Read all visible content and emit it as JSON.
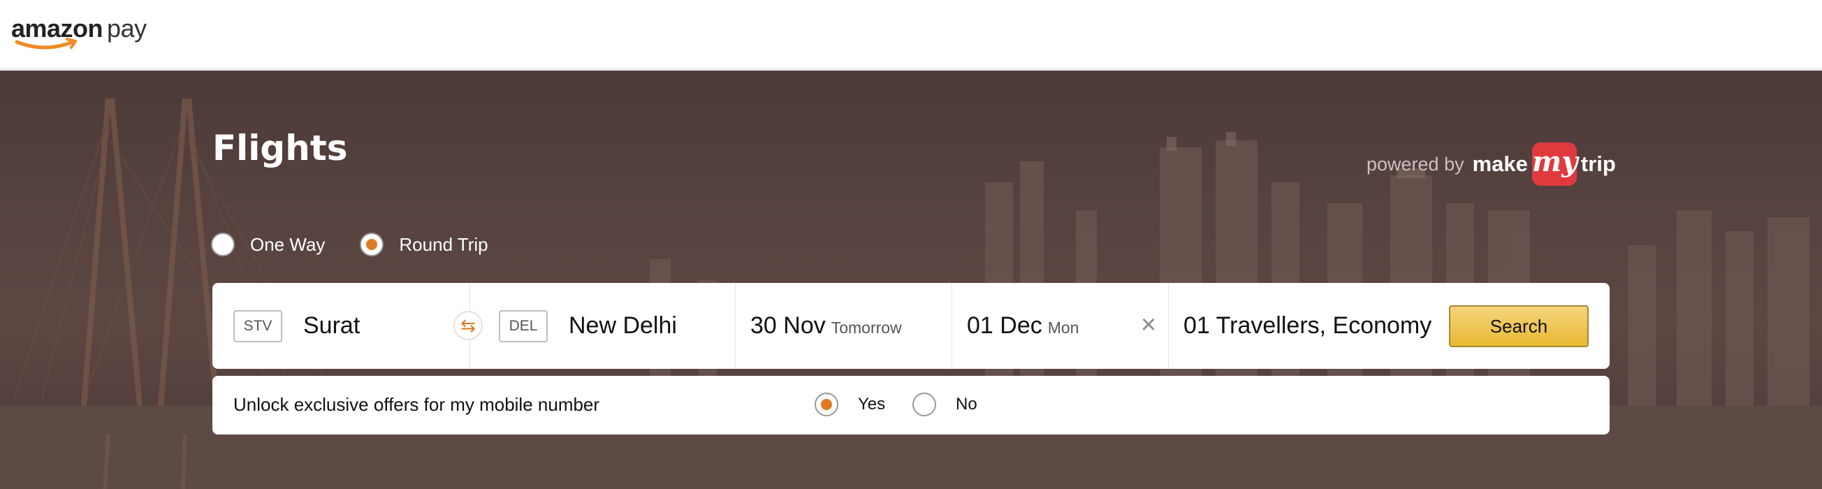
{
  "brand": {
    "logo_text": "amazon",
    "logo_suffix": "pay"
  },
  "page": {
    "title": "Flights"
  },
  "powered_by": {
    "prefix": "powered by",
    "make": "make",
    "my": "my",
    "trip": "trip",
    "brand_color": "#e03a3e"
  },
  "trip_type": {
    "options": [
      {
        "label": "One Way",
        "selected": false
      },
      {
        "label": "Round Trip",
        "selected": true
      }
    ]
  },
  "search": {
    "from": {
      "code": "STV",
      "city": "Surat"
    },
    "to": {
      "code": "DEL",
      "city": "New Delhi"
    },
    "swap_icon": "swap-arrows-icon",
    "depart": {
      "date": "30 Nov",
      "day": "Tomorrow"
    },
    "return": {
      "date": "01 Dec",
      "day": "Mon"
    },
    "clear_icon": "close-icon",
    "travellers": "01 Travellers, Economy",
    "button_label": "Search"
  },
  "offers": {
    "label": "Unlock exclusive offers for my mobile number",
    "options": [
      {
        "label": "Yes",
        "selected": true
      },
      {
        "label": "No",
        "selected": false
      }
    ]
  },
  "colors": {
    "accent": "#e07b24",
    "button": "#f0c14b"
  }
}
